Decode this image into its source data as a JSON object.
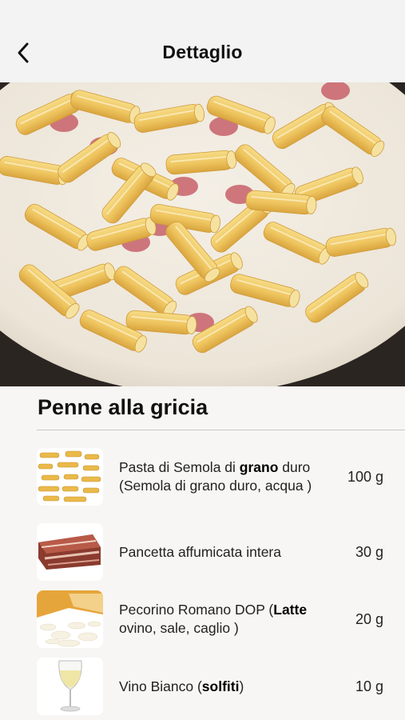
{
  "header": {
    "back_icon": "chevron-left-icon",
    "title": "Dettaglio"
  },
  "hero": {
    "image": "penne-alla-gricia-photo"
  },
  "recipe": {
    "title": "Penne alla gricia"
  },
  "ingredients": [
    {
      "thumb": "pasta-thumbnail",
      "parts": [
        {
          "text": "Pasta di Semola di ",
          "bold": false
        },
        {
          "text": "grano",
          "bold": true
        },
        {
          "text": " duro (Semola di grano duro, acqua )",
          "bold": false
        }
      ],
      "quantity": "100 g"
    },
    {
      "thumb": "pancetta-thumbnail",
      "parts": [
        {
          "text": "Pancetta affumicata intera",
          "bold": false
        }
      ],
      "quantity": "30 g"
    },
    {
      "thumb": "pecorino-thumbnail",
      "parts": [
        {
          "text": "Pecorino Romano DOP (",
          "bold": false
        },
        {
          "text": "Latte",
          "bold": true
        },
        {
          "text": " ovino, sale, caglio )",
          "bold": false
        }
      ],
      "quantity": "20 g"
    },
    {
      "thumb": "wine-glass-thumbnail",
      "parts": [
        {
          "text": "Vino Bianco (",
          "bold": false
        },
        {
          "text": "solfiti",
          "bold": true
        },
        {
          "text": ")",
          "bold": false
        }
      ],
      "quantity": "10 g"
    }
  ]
}
